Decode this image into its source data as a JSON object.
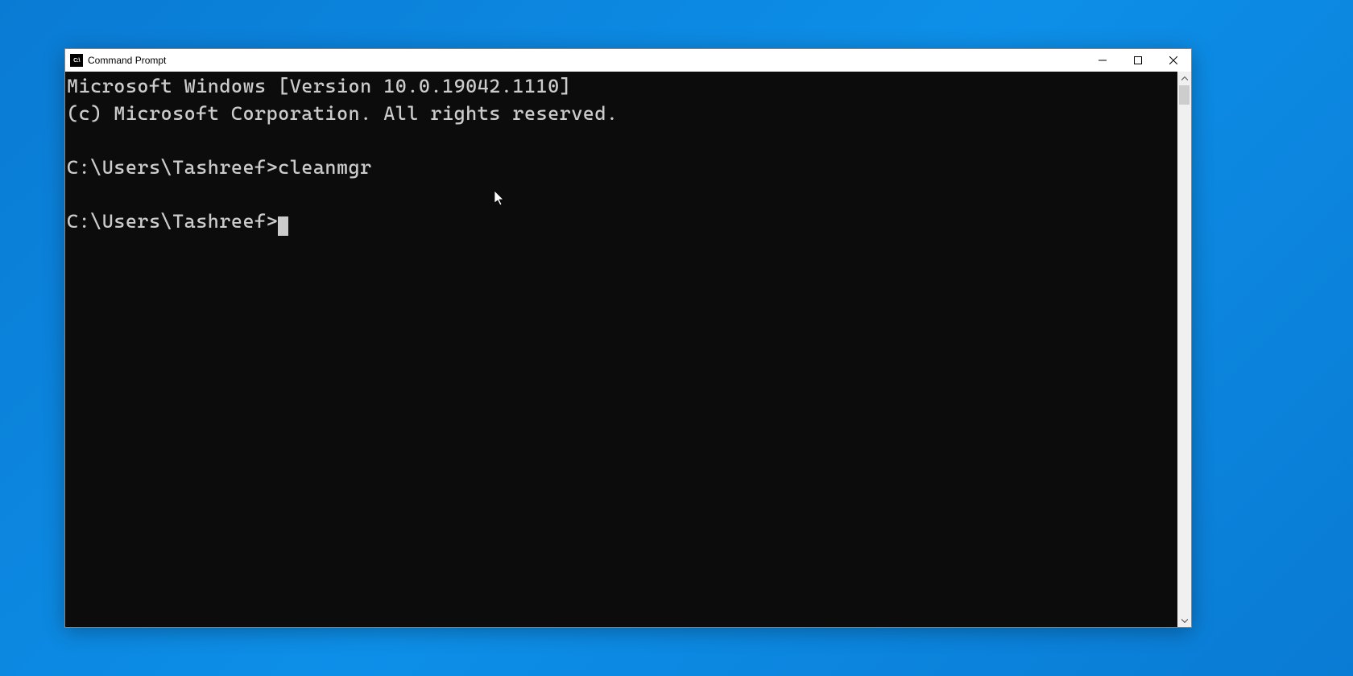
{
  "window": {
    "title": "Command Prompt"
  },
  "terminal": {
    "line1": "Microsoft Windows [Version 10.0.19042.1110]",
    "line2": "(c) Microsoft Corporation. All rights reserved.",
    "blank1": "",
    "prompt1": "C:\\Users\\Tashreef>",
    "command1": "cleanmgr",
    "blank2": "",
    "prompt2": "C:\\Users\\Tashreef>"
  }
}
